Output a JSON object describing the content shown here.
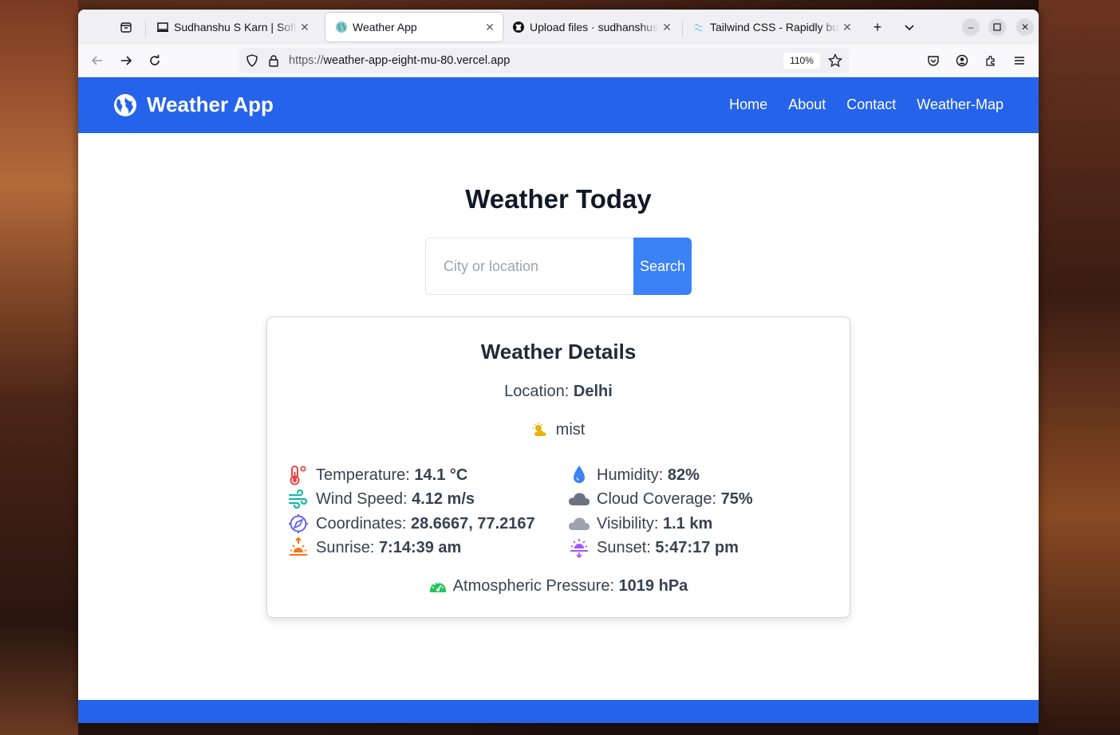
{
  "browser": {
    "tabs": [
      {
        "title": "Sudhanshu S Karn | Software"
      },
      {
        "title": "Weather App"
      },
      {
        "title": "Upload files · sudhanshuskarn"
      },
      {
        "title": "Tailwind CSS - Rapidly build"
      }
    ],
    "url_scheme": "https://",
    "url_host": "weather-app-eight-mu-80.vercel.app",
    "zoom": "110%"
  },
  "site": {
    "brand": "Weather App",
    "nav": [
      "Home",
      "About",
      "Contact",
      "Weather-Map"
    ]
  },
  "main": {
    "heading": "Weather Today",
    "search_placeholder": "City or location",
    "search_button": "Search"
  },
  "details": {
    "title": "Weather Details",
    "location_label": "Location:",
    "location_value": "Delhi",
    "condition": "mist",
    "temperature_label": "Temperature:",
    "temperature_value": "14.1 °C",
    "humidity_label": "Humidity:",
    "humidity_value": "82%",
    "wind_label": "Wind Speed:",
    "wind_value": "4.12 m/s",
    "cloud_label": "Cloud Coverage:",
    "cloud_value": "75%",
    "coords_label": "Coordinates:",
    "coords_value": "28.6667, 77.2167",
    "visibility_label": "Visibility:",
    "visibility_value": "1.1 km",
    "sunrise_label": "Sunrise:",
    "sunrise_value": "7:14:39 am",
    "sunset_label": "Sunset:",
    "sunset_value": "5:47:17 pm",
    "pressure_label": "Atmospheric Pressure:",
    "pressure_value": "1019 hPa"
  },
  "colors": {
    "primary": "#2563eb",
    "button": "#3b82f6"
  },
  "icons": {
    "brand": "globe-icon",
    "condition": "sun-cloud-icon",
    "temperature": "thermometer-icon",
    "humidity": "droplet-icon",
    "wind": "wind-icon",
    "cloud": "cloud-icon",
    "coords": "compass-icon",
    "visibility": "cloud-icon",
    "sunrise": "sunrise-icon",
    "sunset": "sunset-icon",
    "pressure": "gauge-icon"
  }
}
